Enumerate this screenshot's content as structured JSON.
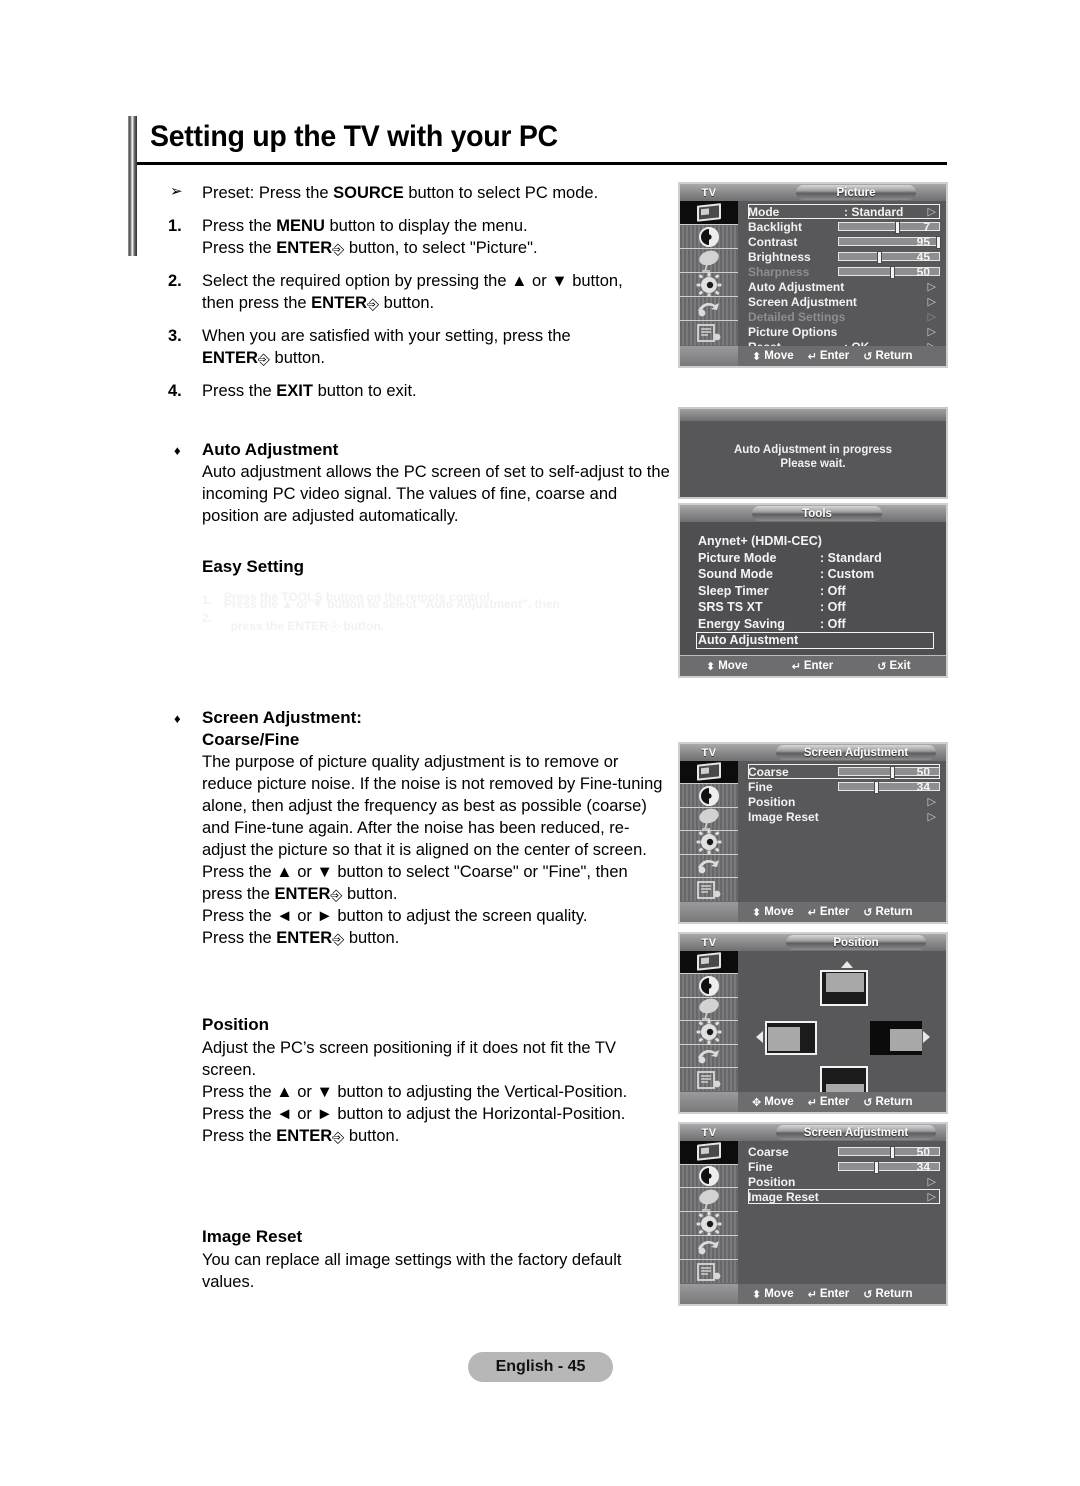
{
  "page": {
    "title": "Setting up the TV with your PC",
    "footer_label": "English - 45"
  },
  "instructions": [
    {
      "marker": "➢",
      "lines": [
        "Preset: Press the SOURCE button to select PC mode."
      ]
    },
    {
      "marker": "1.",
      "lines": [
        "Press the MENU button to display the menu.",
        "Press the ENTER button, to select \"Picture\"."
      ]
    },
    {
      "marker": "2.",
      "lines": [
        "Select the required option by pressing the ▲ or ▼ button,",
        "then press the ENTER button."
      ]
    },
    {
      "marker": "3.",
      "lines": [
        "When you are satisfied with your setting, press the",
        "ENTER button."
      ]
    },
    {
      "marker": "4.",
      "lines": [
        "Press the EXIT button to exit."
      ]
    }
  ],
  "sections": {
    "auto_adjustment": {
      "bullet": "♦",
      "heading": "Auto Adjustment",
      "body": "Auto adjustment allows the PC screen of set to self-adjust to the incoming PC video signal. The values of fine, coarse and position are adjusted automatically.",
      "easy_setting_heading": "Easy Setting",
      "steps": [
        {
          "n": "1.",
          "text": "Press the TOOLS button on the remote control."
        },
        {
          "n": "2.",
          "text": "Press the ▲ or ▼ button to select “Auto Adjustment”, then press the ENTER button."
        }
      ]
    },
    "screen_adjustment": {
      "bullet": "♦",
      "heading_line1": "Screen Adjustment:",
      "heading_line2": "Coarse/Fine",
      "body": "The purpose of picture quality adjustment is to remove or reduce picture noise. If the noise is not removed by Fine-tuning alone, then adjust the frequency as best as possible (coarse) and Fine-tune again. After the noise has been reduced, re-adjust the picture so that it is aligned on the center of screen.",
      "body2_line1": "Press the ▲ or ▼ button to select \"Coarse\" or \"Fine\", then",
      "body2_line2": "press the ENTER button.",
      "body2_line3": "Press the ◄ or ► button to adjust the screen quality.",
      "body2_line4": "Press the ENTER button."
    },
    "position": {
      "heading": "Position",
      "line1": "Adjust the PC’s screen positioning if it does not fit the TV",
      "line2": "screen.",
      "line3": "Press the ▲ or ▼ button to adjusting the Vertical-Position.",
      "line4": "Press the ◄ or ► button to adjust the Horizontal-Position.",
      "line5": "Press the ENTER button."
    },
    "image_reset": {
      "heading": "Image Reset",
      "body": "You can replace all image settings with the factory default values."
    }
  },
  "osd": {
    "tv_label": "TV",
    "picture_menu": {
      "title": "Picture",
      "rows": [
        {
          "label": "Mode",
          "value": ": Standard",
          "kind": "value",
          "highlight": true,
          "caret": "▷"
        },
        {
          "label": "Backlight",
          "kind": "slider",
          "percent": 55,
          "number": "7"
        },
        {
          "label": "Contrast",
          "kind": "slider",
          "percent": 95,
          "number": "95"
        },
        {
          "label": "Brightness",
          "kind": "slider",
          "percent": 37,
          "number": "45"
        },
        {
          "label": "Sharpness",
          "kind": "slider",
          "percent": 50,
          "number": "50",
          "dim": true
        },
        {
          "label": "Auto Adjustment",
          "kind": "arrow",
          "caret": "▷"
        },
        {
          "label": "Screen Adjustment",
          "kind": "arrow",
          "caret": "▷"
        },
        {
          "label": "Detailed Settings",
          "kind": "arrow",
          "caret": "▷",
          "dim": true
        },
        {
          "label": "Picture Options",
          "kind": "arrow",
          "caret": "▷"
        },
        {
          "label": "Reset",
          "value": ": OK",
          "kind": "value",
          "caret": "▷"
        }
      ],
      "actions": [
        {
          "glyph": "⬍",
          "label": "Move"
        },
        {
          "glyph": "↵",
          "label": "Enter"
        },
        {
          "glyph": "↺",
          "label": "Return"
        }
      ]
    },
    "auto_adjust_message": {
      "line1": "Auto Adjustment in progress",
      "line2": "Please wait."
    },
    "tools_menu": {
      "title": "Tools",
      "rows": [
        {
          "label": "Anynet+ (HDMI-CEC)",
          "value": ""
        },
        {
          "label": "Picture Mode",
          "value": ": Standard"
        },
        {
          "label": "Sound Mode",
          "value": ": Custom"
        },
        {
          "label": "Sleep Timer",
          "value": ": Off"
        },
        {
          "label": "SRS TS XT",
          "value": ": Off"
        },
        {
          "label": "Energy Saving",
          "value": ": Off"
        },
        {
          "label": "Auto Adjustment",
          "value": "",
          "highlight": true
        }
      ],
      "actions": [
        {
          "glyph": "⬍",
          "label": "Move"
        },
        {
          "glyph": "↵",
          "label": "Enter"
        },
        {
          "glyph": "↺",
          "label": "Exit"
        }
      ]
    },
    "screen_adjustment_menu": {
      "title": "Screen Adjustment",
      "rows": [
        {
          "label": "Coarse",
          "kind": "slider",
          "percent": 50,
          "number": "50",
          "highlight": true
        },
        {
          "label": "Fine",
          "kind": "slider",
          "percent": 34,
          "number": "34"
        },
        {
          "label": "Position",
          "kind": "arrow",
          "caret": "▷"
        },
        {
          "label": "Image Reset",
          "kind": "arrow",
          "caret": "▷"
        }
      ],
      "actions": [
        {
          "glyph": "⬍",
          "label": "Move"
        },
        {
          "glyph": "↵",
          "label": "Enter"
        },
        {
          "glyph": "↺",
          "label": "Return"
        }
      ]
    },
    "position_menu": {
      "title": "Position",
      "actions": [
        {
          "glyph": "✥",
          "label": "Move"
        },
        {
          "glyph": "↵",
          "label": "Enter"
        },
        {
          "glyph": "↺",
          "label": "Return"
        }
      ]
    },
    "screen_adjustment_menu2": {
      "title": "Screen Adjustment",
      "rows": [
        {
          "label": "Coarse",
          "kind": "slider",
          "percent": 50,
          "number": "50"
        },
        {
          "label": "Fine",
          "kind": "slider",
          "percent": 34,
          "number": "34"
        },
        {
          "label": "Position",
          "kind": "arrow",
          "caret": "▷"
        },
        {
          "label": "Image Reset",
          "kind": "arrow",
          "caret": "▷",
          "highlight": true
        }
      ],
      "actions": [
        {
          "glyph": "⬍",
          "label": "Move"
        },
        {
          "glyph": "↵",
          "label": "Enter"
        },
        {
          "glyph": "↺",
          "label": "Return"
        }
      ]
    },
    "sidebar_icons": [
      "picture-icon",
      "sound-icon",
      "channel-icon",
      "setup-icon",
      "input-icon",
      "support-icon"
    ]
  }
}
